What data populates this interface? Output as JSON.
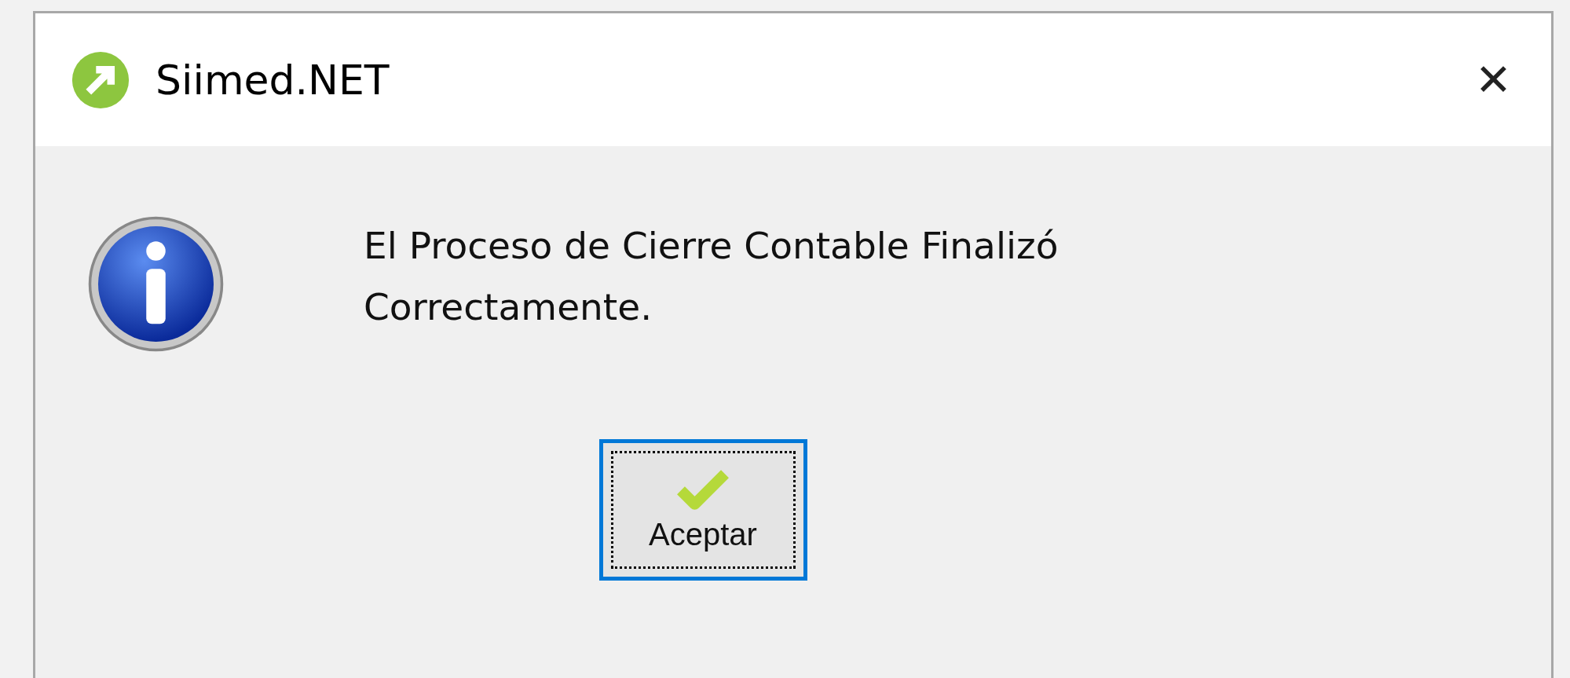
{
  "window": {
    "title": "Siimed.NET",
    "close": "✕"
  },
  "message": {
    "lines": [
      "El Proceso de Cierre Contable Finalizó",
      "Correctamente."
    ]
  },
  "buttons": [
    {
      "label": "Aceptar",
      "focused": true
    }
  ]
}
